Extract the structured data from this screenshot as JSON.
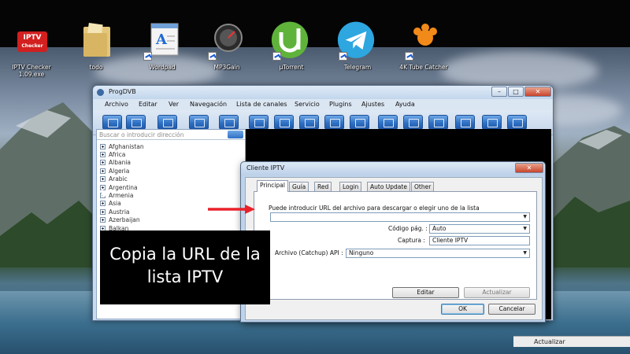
{
  "desktop": {
    "icons": [
      {
        "label": "IPTV Checker 1.09.exe",
        "icon": "iptv-checker-icon",
        "badge": "IPTV\nChecker"
      },
      {
        "label": "todo",
        "icon": "folder-icon"
      },
      {
        "label": "Wordpad",
        "icon": "wordpad-icon"
      },
      {
        "label": "MP3Gain",
        "icon": "mp3gain-icon"
      },
      {
        "label": "µTorrent",
        "icon": "utorrent-icon"
      },
      {
        "label": "Telegram",
        "icon": "telegram-icon"
      },
      {
        "label": "4K Tube Catcher",
        "icon": "tube-catcher-icon"
      }
    ]
  },
  "progdvb": {
    "title": "ProgDVB",
    "menu": [
      "Archivo",
      "Editar",
      "Ver",
      "Navegación",
      "Lista de canales",
      "Servicio",
      "Plugins",
      "Ajustes",
      "Ayuda"
    ],
    "search_placeholder": "Buscar o introducir dirección",
    "channel_groups": [
      "Afghanistan",
      "Africa",
      "Albania",
      "Algeria",
      "Arabic",
      "Argentina",
      "Armenia",
      "Asia",
      "Austria",
      "Azerbaijan",
      "Balkan"
    ]
  },
  "dialog": {
    "title": "Cliente IPTV",
    "tabs": [
      "Principal",
      "Guía",
      "Red",
      "Login",
      "Auto Update",
      "Other"
    ],
    "active_tab": "Principal",
    "url_label": "Puede introducir URL del archivo para descargar o elegir uno de la lista",
    "url_value": "",
    "codepage_label": "Código pág. :",
    "codepage_value": "Auto",
    "capture_label": "Captura :",
    "capture_value": "Cliente IPTV",
    "archive_label": "Archivo (Catchup) API :",
    "archive_value": "Ninguno",
    "edit_button": "Editar",
    "update_button": "Actualizar",
    "ok_button": "OK",
    "cancel_button": "Cancelar"
  },
  "annotation": {
    "caption": "Copia la URL de la lista IPTV",
    "arrow_color": "#e8222a"
  },
  "bottom_strip": {
    "label": "Actualizar"
  },
  "colors": {
    "accent_blue": "#2f70c4",
    "window_frame": "#c9dbef"
  }
}
